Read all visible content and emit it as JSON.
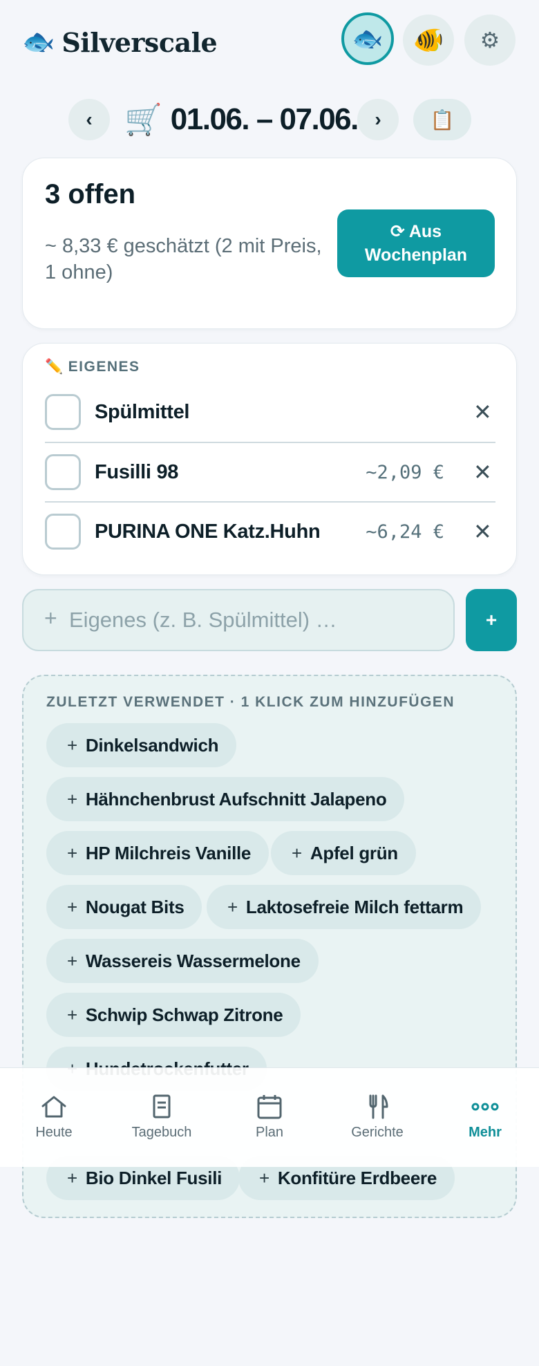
{
  "header": {
    "app_name": "Silverscale",
    "brand_icon": "fish-icon",
    "buttons": [
      {
        "icon": "fish-icon",
        "glyph": "🐟",
        "active": true
      },
      {
        "icon": "tropical-fish-icon",
        "glyph": "🐠",
        "active": false
      },
      {
        "icon": "gear-icon",
        "glyph": "⚙",
        "active": false
      }
    ]
  },
  "week": {
    "prev": "‹",
    "next": "›",
    "cart_glyph": "🛒",
    "range": "01.06. – 07.06.",
    "clipboard_glyph": "📋"
  },
  "summary": {
    "open_count": "3 offen",
    "estimate": "~ 8,33 € geschätzt (2 mit Preis, 1 ohne)",
    "from_plan_button": "⟳ Aus Wochenplan"
  },
  "own_items": {
    "label_glyph": "✏️",
    "label": "EIGENES",
    "items": [
      {
        "name": "Spülmittel",
        "price": "",
        "checked": false
      },
      {
        "name": "Fusilli 98",
        "price": "~2,09 €",
        "checked": false
      },
      {
        "name": "PURINA ONE Katz.Huhn",
        "price": "~6,24 €",
        "checked": false
      }
    ],
    "remove_glyph": "✕"
  },
  "add_item": {
    "placeholder": "Eigenes (z. B. Spülmittel) …",
    "plus_glyph": "+",
    "button_label": "+"
  },
  "recent": {
    "label": "ZULETZT VERWENDET · 1 KLICK ZUM HINZUFÜGEN",
    "plus_glyph": "+",
    "chips": [
      "Dinkelsandwich",
      "Hähnchenbrust Aufschnitt Jalapeno",
      "HP Milchreis Vanille",
      "Apfel grün",
      "Nougat Bits",
      "Laktosefreie Milch fettarm",
      "Wassereis Wassermelone",
      "Schwip Schwap Zitrone",
      "Hundetrockenfutter",
      "Bio Dinkel Fusili",
      "Konfitüre Erdbeere"
    ]
  },
  "nav": {
    "items": [
      {
        "label": "Heute",
        "icon": "home-icon",
        "active": false
      },
      {
        "label": "Tagebuch",
        "icon": "journal-icon",
        "active": false
      },
      {
        "label": "Plan",
        "icon": "calendar-icon",
        "active": false
      },
      {
        "label": "Gerichte",
        "icon": "fork-knife-icon",
        "active": false
      },
      {
        "label": "Mehr",
        "icon": "more-dots-icon",
        "active": true
      }
    ]
  },
  "colors": {
    "accent": "#0f9aa2",
    "background": "#f4f6fa",
    "chip": "#d9e9ea"
  }
}
